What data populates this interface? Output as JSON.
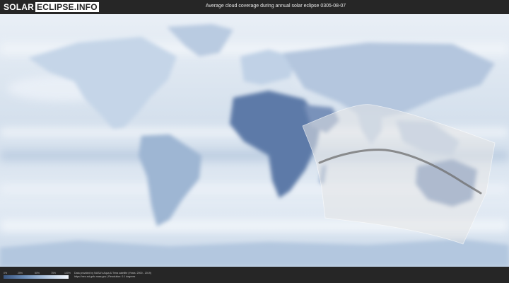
{
  "header": {
    "logo_solar": "SOLAR",
    "logo_eclipse": "ECLIPSE.INFO",
    "title": "Average cloud coverage during annual solar eclipse 0305-08-07"
  },
  "legend": {
    "ticks": [
      "0%",
      "25%",
      "50%",
      "75%",
      "100%"
    ],
    "gradient_start_color": "#39557f",
    "gradient_end_color": "#f4f8fc"
  },
  "credit": {
    "line1": "Data provided by NASA's Aqua & Terra satellite (Years: 2000 - 2019)",
    "line2": "https://neo.sci.gsfc.nasa.gov | Resolution: 0.1 degrees"
  },
  "colors": {
    "background": "#262626",
    "ocean_cloud": "#d9e4f0",
    "land_clear": "#5a78a6",
    "eclipse_path": "#e6e6e6"
  }
}
